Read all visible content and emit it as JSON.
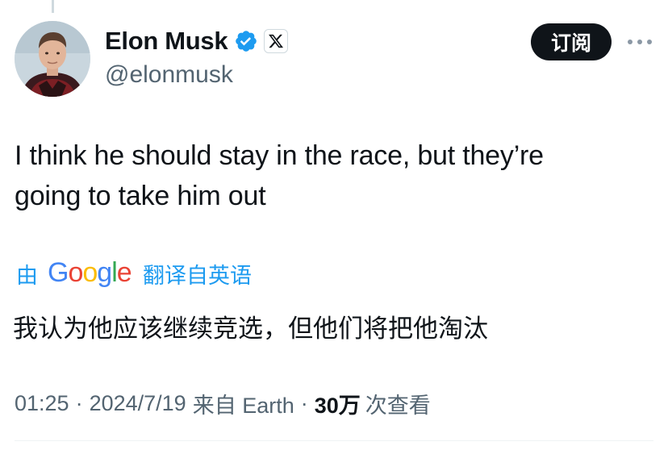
{
  "author": {
    "display_name": "Elon Musk",
    "handle": "@elonmusk",
    "verified_icon": "verified-badge-icon",
    "affiliate_icon": "x-logo-icon"
  },
  "header": {
    "subscribe_label": "订阅",
    "more_icon": "more-horizontal-icon"
  },
  "tweet": {
    "text_line1": "I think he should stay in the race, but they’re",
    "text_line2": "going to take him out"
  },
  "translation": {
    "prefix": "由",
    "provider": "Google",
    "suffix": "翻译自英语",
    "translated_text": "我认为他应该继续竞选，但他们将把他淘汰"
  },
  "meta": {
    "time": "01:25",
    "date": "2024/7/19",
    "source": "来自 Earth",
    "separator": "·",
    "views_count": "30万",
    "views_label": "次查看"
  },
  "colors": {
    "accent": "#1d9bf0",
    "text_primary": "#0f1419",
    "text_secondary": "#536471",
    "button_bg": "#0f1419",
    "google_blue": "#4285F4",
    "google_red": "#EA4335",
    "google_yellow": "#FBBC05",
    "google_green": "#34A853"
  }
}
